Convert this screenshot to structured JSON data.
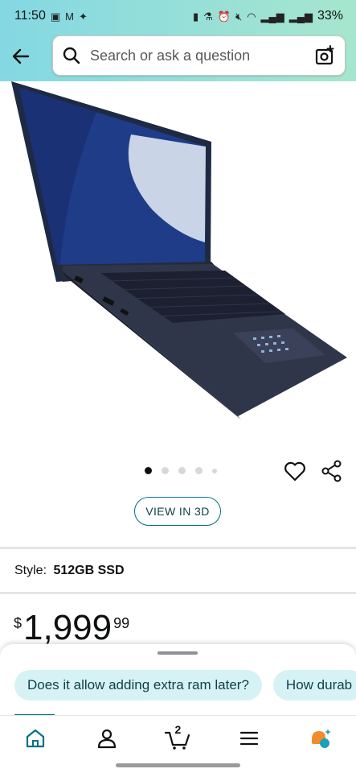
{
  "status_bar": {
    "time": "11:50",
    "battery": "33%"
  },
  "search": {
    "placeholder": "Search or ask a question"
  },
  "carousel": {
    "dot_count": 5,
    "active_index": 0
  },
  "view3d_label": "VIEW IN 3D",
  "style": {
    "label": "Style:",
    "value": "512GB SSD"
  },
  "price": {
    "symbol": "$",
    "whole": "1,999",
    "fraction": "99"
  },
  "chips": [
    {
      "label": "Does it allow adding extra ram later?"
    },
    {
      "label": "How durab"
    }
  ],
  "nav": {
    "cart_count": "2"
  },
  "colors": {
    "accent": "#007185",
    "header_gradient_start": "#84d8e3",
    "header_gradient_end": "#a6e6ce",
    "chip_bg": "#d7f2f4"
  }
}
